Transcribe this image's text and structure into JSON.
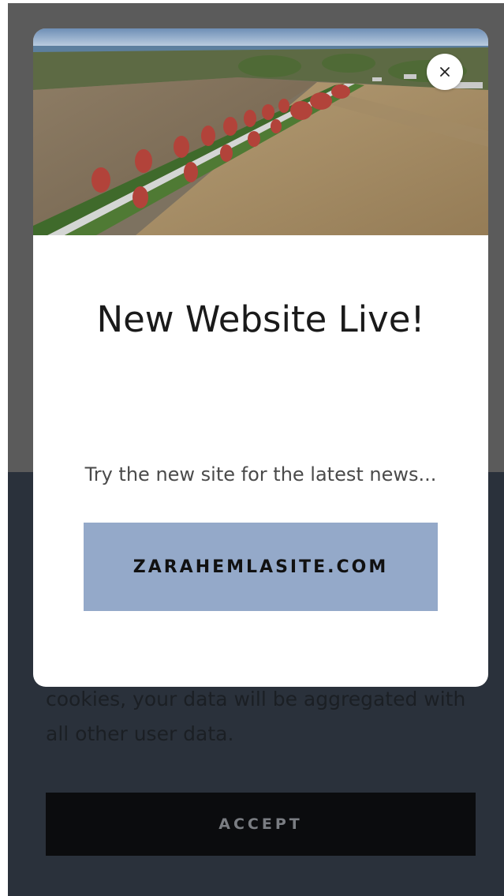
{
  "background_page": {
    "cookie_text": "cookies, your data will be aggregated with all other user data.",
    "accept_label": "ACCEPT"
  },
  "modal": {
    "title": "New Website Live!",
    "subtitle": "Try the new site for the latest news...",
    "cta_label": "ZARAHEMLASITE.COM",
    "close_icon": "close-icon",
    "cta_color": "#94a9c9"
  }
}
